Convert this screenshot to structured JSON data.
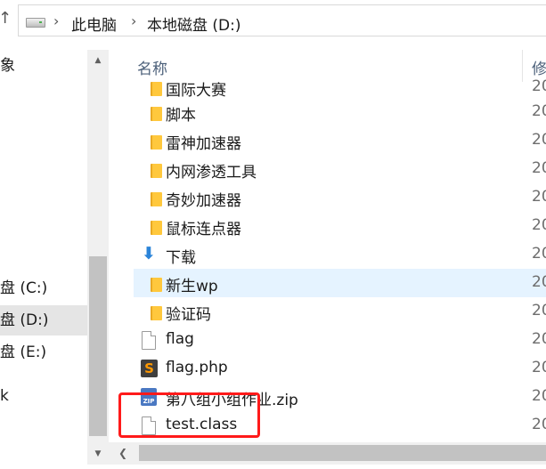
{
  "address_bar": {
    "up_glyph": "↑",
    "chevrons": [
      "›",
      "›"
    ],
    "crumbs": [
      "此电脑",
      "本地磁盘 (D:)"
    ]
  },
  "nav_pane": {
    "items": [
      {
        "label": "象",
        "selected": false
      },
      {
        "label": "盘 (C:)",
        "selected": false
      },
      {
        "label": "盘 (D:)",
        "selected": true
      },
      {
        "label": "盘 (E:)",
        "selected": false
      },
      {
        "label": "k",
        "selected": false
      }
    ]
  },
  "columns": {
    "sort_glyph": "˄",
    "name_header": "名称",
    "modified_header": "修"
  },
  "files": [
    {
      "name": "国际大赛",
      "type": "folder",
      "date": "20",
      "selected": false
    },
    {
      "name": "脚本",
      "type": "folder",
      "date": "20",
      "selected": false
    },
    {
      "name": "雷神加速器",
      "type": "folder",
      "date": "20",
      "selected": false
    },
    {
      "name": "内网渗透工具",
      "type": "folder",
      "date": "20",
      "selected": false
    },
    {
      "name": "奇妙加速器",
      "type": "folder",
      "date": "20",
      "selected": false
    },
    {
      "name": "鼠标连点器",
      "type": "folder",
      "date": "20",
      "selected": false
    },
    {
      "name": "下载",
      "type": "download",
      "date": "20",
      "selected": false
    },
    {
      "name": "新生wp",
      "type": "folder",
      "date": "20",
      "selected": true
    },
    {
      "name": "验证码",
      "type": "folder",
      "date": "20",
      "selected": false
    },
    {
      "name": "flag",
      "type": "file",
      "date": "20",
      "selected": false
    },
    {
      "name": "flag.php",
      "type": "sublime",
      "date": "20",
      "selected": false
    },
    {
      "name": "第八组小组作业.zip",
      "type": "zip",
      "date": "20",
      "selected": false
    },
    {
      "name": "test.class",
      "type": "file",
      "date": "20",
      "selected": false
    }
  ],
  "icons": {
    "sublime_glyph": "S",
    "zip_glyph": "ZIP",
    "download_glyph": "⬇",
    "scroll_up": "▲",
    "scroll_down": "▼",
    "scroll_left": "❮"
  },
  "colors": {
    "selection": "#e5f3ff",
    "nav_selection": "#e5e5e5",
    "annotation_box": "#ff1a1a",
    "folder": "#ffc83d"
  }
}
